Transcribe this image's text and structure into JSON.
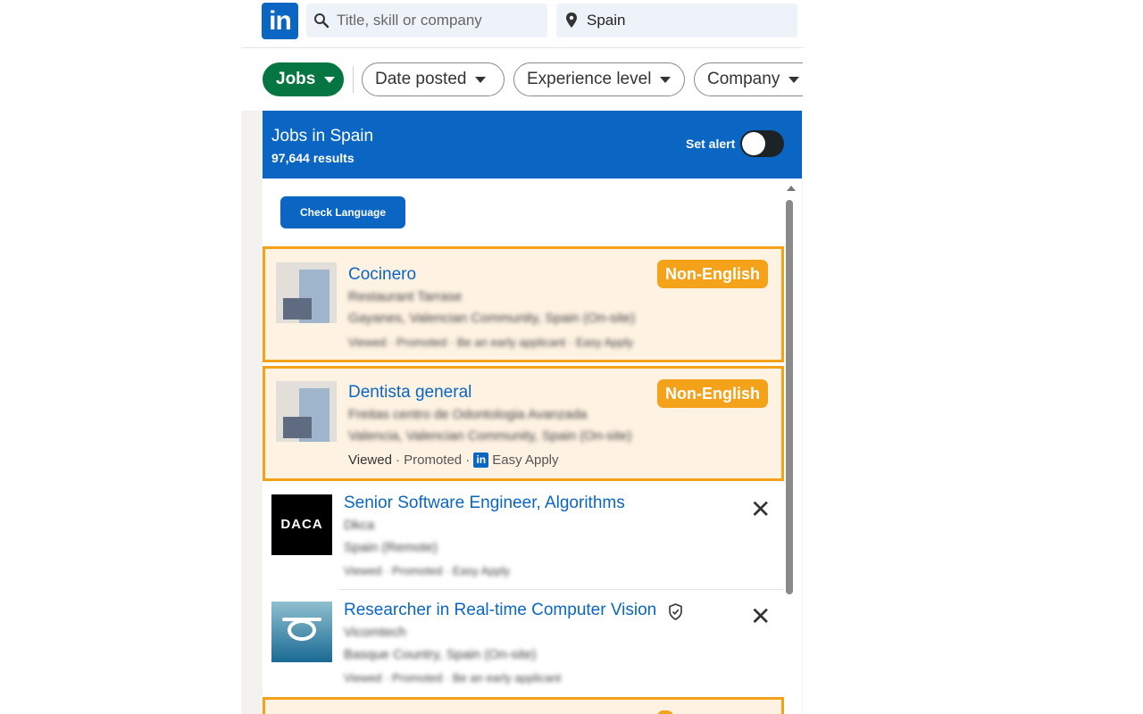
{
  "header": {
    "logo": "in",
    "keyword_placeholder": "Title, skill or company",
    "location_value": "Spain"
  },
  "filters": {
    "jobs": "Jobs",
    "date": "Date posted",
    "experience": "Experience level",
    "company": "Company"
  },
  "banner": {
    "title": "Jobs in Spain",
    "count": "97,644 results",
    "alert_label": "Set alert",
    "alert_on": false
  },
  "check_button": "Check Language",
  "badge_label": "Non-English",
  "jobs": [
    {
      "title": "Cocinero",
      "company": "Restaurant Tarrase",
      "location": "Gayanes, Valencian Community, Spain (On-site)",
      "meta": "Viewed · Promoted · Be an early applicant · Easy Apply"
    },
    {
      "title": "Dentista general",
      "company": "Freitas centro de Odontologia Avanzada",
      "location": "Valencia, Valencian Community, Spain (On-site)",
      "meta_viewed": "Viewed",
      "meta_rest": "· Promoted ·",
      "meta_easy": "Easy Apply"
    },
    {
      "title": "Senior Software Engineer, Algorithms",
      "company": "Dkca",
      "location": "Spain (Remote)",
      "meta": "Viewed · Promoted · Easy Apply",
      "logo_text": "DACA"
    },
    {
      "title": "Researcher in Real-time Computer Vision",
      "company": "Vicomtech",
      "location": "Basque Country, Spain (On-site)",
      "meta": "Viewed · Promoted · Be an early applicant"
    }
  ],
  "icons": {
    "search": "search-icon",
    "location": "location-pin-icon",
    "close": "close-icon",
    "verified": "shield-check-icon"
  },
  "colors": {
    "brand": "#0a66c2",
    "jobs_pill": "#057642",
    "highlight": "#f5a21b",
    "highlight_bg": "#fef2e3"
  }
}
